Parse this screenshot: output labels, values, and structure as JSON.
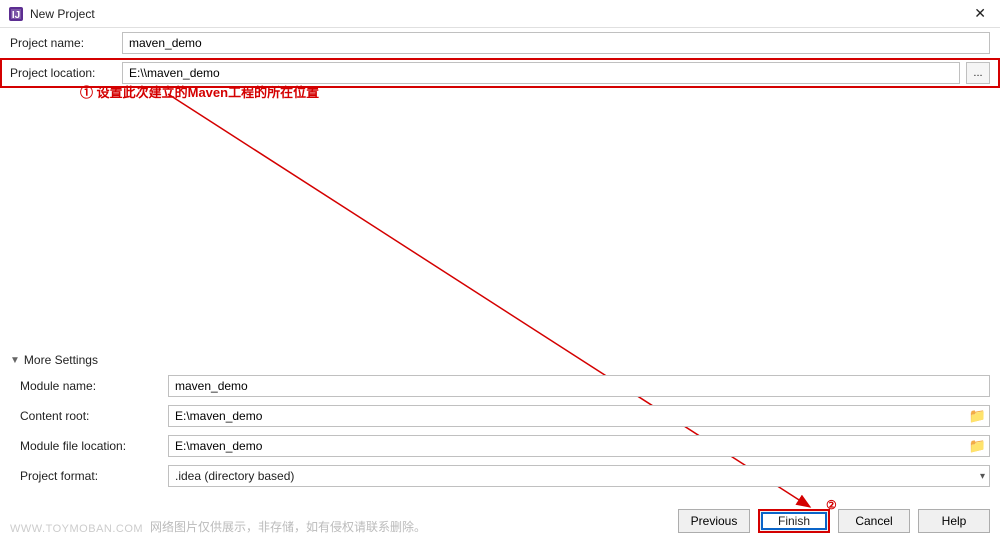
{
  "window": {
    "title": "New Project",
    "close": "✕"
  },
  "fields": {
    "project_name_label": "Project name:",
    "project_name_value": "maven_demo",
    "project_location_label": "Project location:",
    "project_location_value": "E:\\\\maven_demo",
    "browse_label": "..."
  },
  "annotations": {
    "a1": "① 设置此次建立的Maven工程的所在位置",
    "a2": "②"
  },
  "more_settings": {
    "toggle_label": "More Settings",
    "module_name_label": "Module name:",
    "module_name_value": "maven_demo",
    "content_root_label": "Content root:",
    "content_root_value": "E:\\maven_demo",
    "module_file_location_label": "Module file location:",
    "module_file_location_value": "E:\\maven_demo",
    "project_format_label": "Project format:",
    "project_format_value": ".idea (directory based)"
  },
  "buttons": {
    "previous": "Previous",
    "finish": "Finish",
    "cancel": "Cancel",
    "help": "Help"
  },
  "footer": {
    "watermark": "WWW.TOYMOBAN.COM",
    "note": "网络图片仅供展示，非存储，如有侵权请联系删除。"
  },
  "icons": {
    "folder": "📁",
    "chevron_down": "▾",
    "arrow_down": "▼"
  }
}
